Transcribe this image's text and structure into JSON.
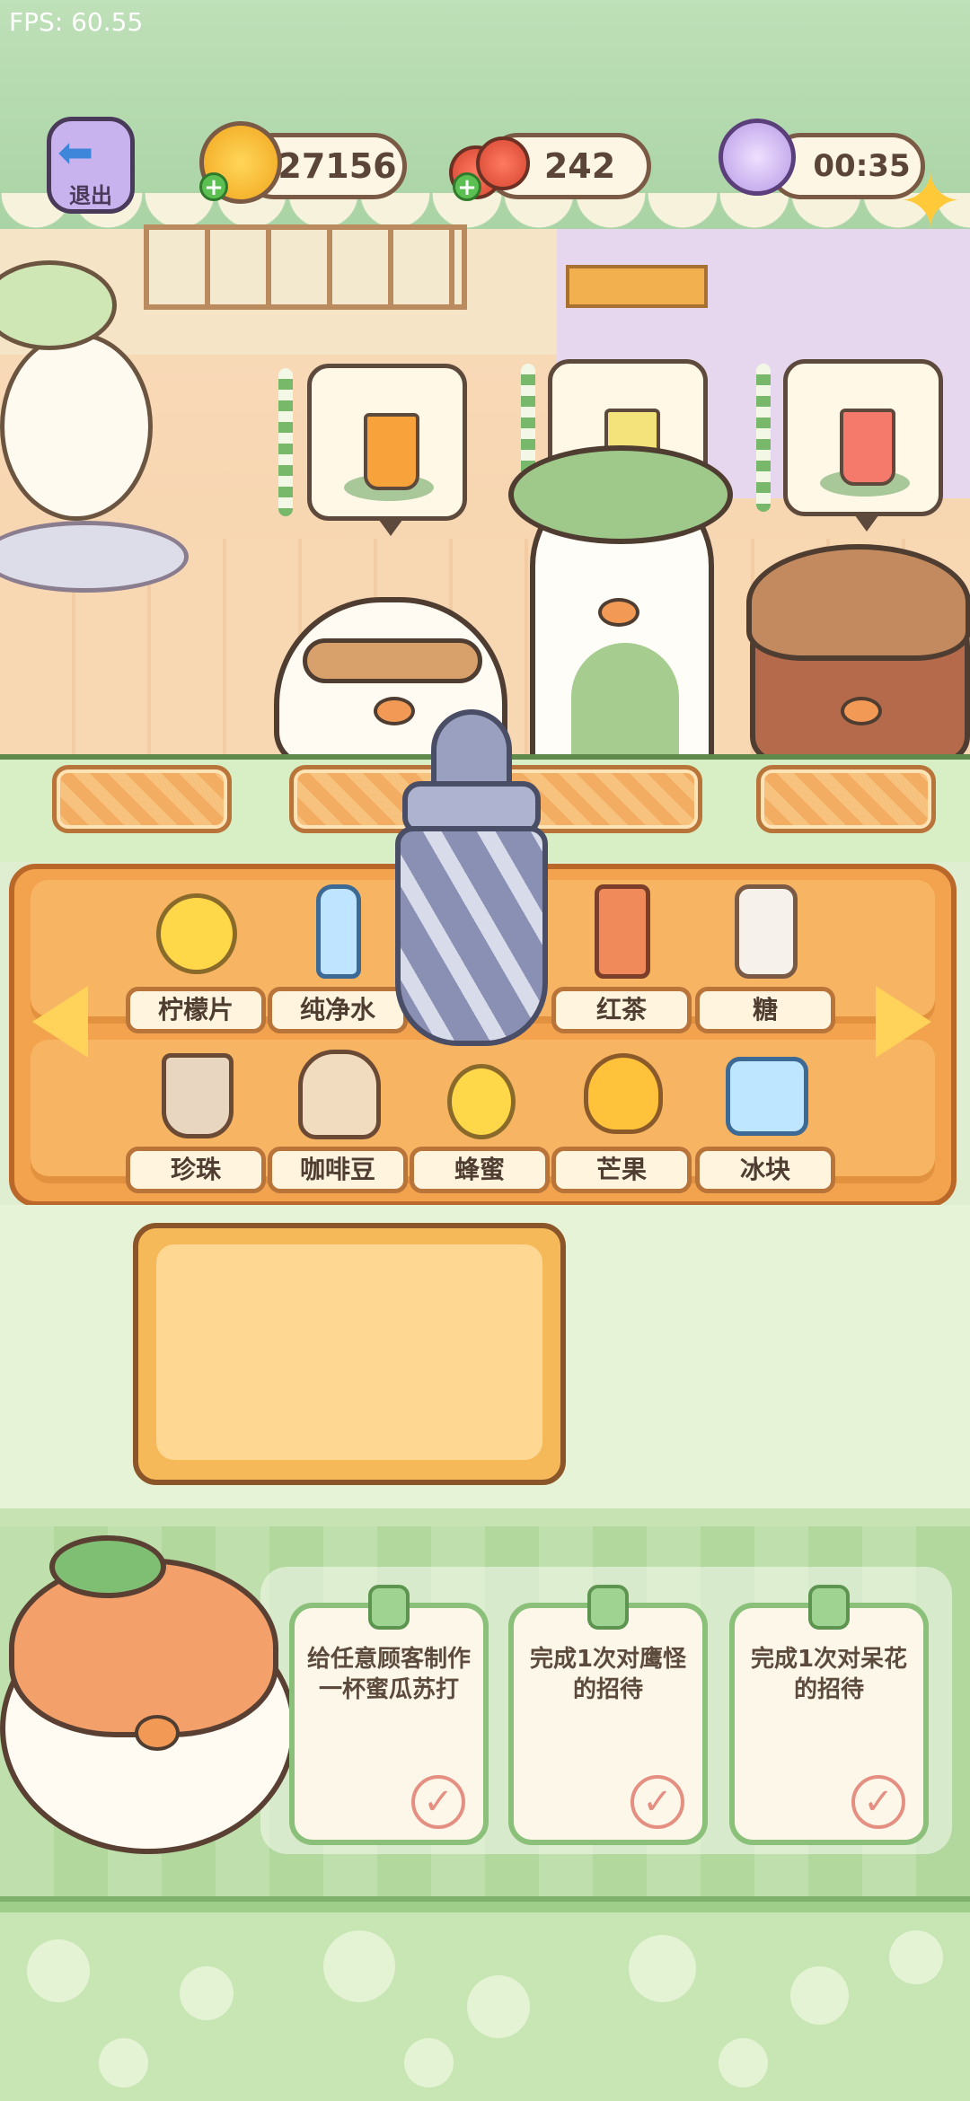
{
  "hud": {
    "fps": "FPS: 60.55",
    "exit_label": "退出",
    "coins": "27156",
    "berries": "242",
    "timer": "00:35"
  },
  "orders": [
    {
      "drink": "orange-soda",
      "color": "#f7a23a"
    },
    {
      "drink": "lemon-drink",
      "color": "#f4e27a"
    },
    {
      "drink": "berry-soda",
      "color": "#f57a6c"
    }
  ],
  "ingredients": [
    {
      "label": "柠檬片",
      "icon": "lemon-slices-icon"
    },
    {
      "label": "纯净水",
      "icon": "water-bottle-icon"
    },
    {
      "label": "",
      "icon": "hidden-slot-icon"
    },
    {
      "label": "红茶",
      "icon": "black-tea-icon"
    },
    {
      "label": "糖",
      "icon": "sugar-jar-icon"
    },
    {
      "label": "珍珠",
      "icon": "pearls-icon"
    },
    {
      "label": "咖啡豆",
      "icon": "coffee-beans-icon"
    },
    {
      "label": "蜂蜜",
      "icon": "honey-icon"
    },
    {
      "label": "芒果",
      "icon": "mango-icon"
    },
    {
      "label": "冰块",
      "icon": "ice-cubes-icon"
    }
  ],
  "tasks": [
    {
      "text": "给任意顾客制作一杯蜜瓜苏打"
    },
    {
      "text": "完成1次对鹰怪的招待"
    },
    {
      "text": "完成1次对呆花的招待"
    }
  ],
  "colors": {
    "accent_green": "#8bc07a",
    "shelf_orange": "#f3a24d",
    "check_red": "#e58f82"
  }
}
